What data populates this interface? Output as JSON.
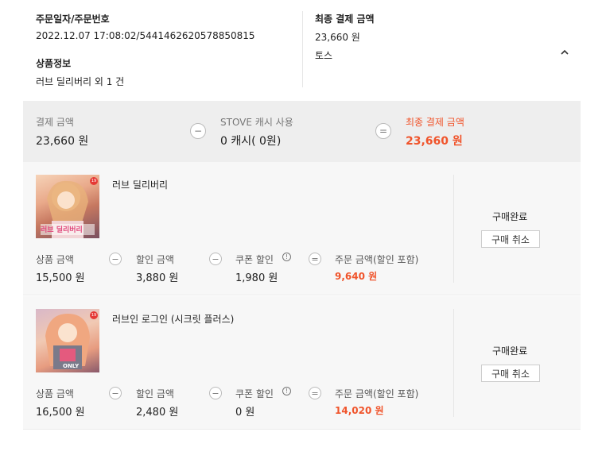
{
  "summary": {
    "order_label": "주문일자/주문번호",
    "order_value": "2022.12.07 17:08:02/5441462620578850815",
    "product_label": "상품정보",
    "product_value": "러브 딜리버리 외 1 건",
    "final_label": "최종 결제 금액",
    "final_amount": "23,660 원",
    "payment_method": "토스",
    "collapse_icon": "chevron-up-icon"
  },
  "totals": {
    "payment_label": "결제 금액",
    "payment_value": "23,660 원",
    "minus_sign": "−",
    "cash_label": "STOVE 캐시 사용",
    "cash_value": "0 캐시( 0원)",
    "equals_sign": "=",
    "final_label": "최종 결제 금액",
    "final_value": "23,660 원",
    "accent_color": "#f0542b"
  },
  "items": [
    {
      "title": "러브 딜리버리",
      "thumb_caption": "러브 딜리버리",
      "price_label": "상품 금액",
      "price_value": "15,500 원",
      "discount_label": "할인 금액",
      "discount_value": "3,880 원",
      "coupon_label": "쿠폰 할인",
      "coupon_value": "1,980 원",
      "order_label": "주문 금액(할인 포함)",
      "order_value": "9,640 원",
      "status": "구매완료",
      "cancel_label": "구매 취소",
      "minus": "−",
      "equals": "="
    },
    {
      "title": "러브인 로그인 (시크릿 플러스)",
      "thumb_caption": "ONLY",
      "price_label": "상품 금액",
      "price_value": "16,500 원",
      "discount_label": "할인 금액",
      "discount_value": "2,480 원",
      "coupon_label": "쿠폰 할인",
      "coupon_value": "0 원",
      "order_label": "주문 금액(할인 포함)",
      "order_value": "14,020 원",
      "status": "구매완료",
      "cancel_label": "구매 취소",
      "minus": "−",
      "equals": "="
    }
  ]
}
